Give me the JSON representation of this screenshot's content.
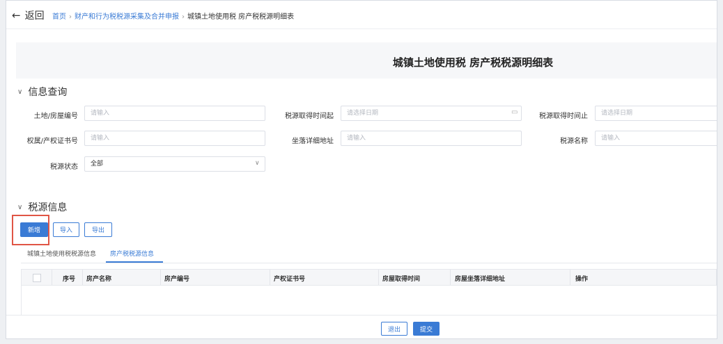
{
  "header": {
    "back_label": "返回",
    "breadcrumb": [
      "首页",
      "财产和行为税税源采集及合并申报",
      "城镇土地使用税 房产税税源明细表"
    ]
  },
  "page_title": "城镇土地使用税 房产税税源明细表",
  "query": {
    "section_title": "信息查询",
    "fields": {
      "land_no": {
        "label": "土地/房屋编号",
        "placeholder": "请输入"
      },
      "acquire_start": {
        "label": "税源取得时间起",
        "placeholder": "请选择日期"
      },
      "acquire_end": {
        "label": "税源取得时间止",
        "placeholder": "请选择日期"
      },
      "cert_no": {
        "label": "权属/产权证书号",
        "placeholder": "请输入"
      },
      "address": {
        "label": "坐落详细地址",
        "placeholder": "请输入"
      },
      "source_name": {
        "label": "税源名称",
        "placeholder": "请输入"
      },
      "status": {
        "label": "税源状态",
        "value": "全部"
      }
    }
  },
  "source": {
    "section_title": "税源信息",
    "buttons": {
      "add": "新增",
      "import": "导入",
      "export": "导出"
    },
    "tabs": [
      "城镇土地使用税税源信息",
      "房产税税源信息"
    ],
    "active_tab": 1,
    "columns": [
      "序号",
      "房产名称",
      "房产编号",
      "产权证书号",
      "房屋取得时间",
      "房屋坐落详细地址",
      "操作"
    ]
  },
  "footer": {
    "exit": "退出",
    "submit": "提交"
  },
  "colors": {
    "accent": "#3a7bd5",
    "highlight": "#e05545"
  }
}
